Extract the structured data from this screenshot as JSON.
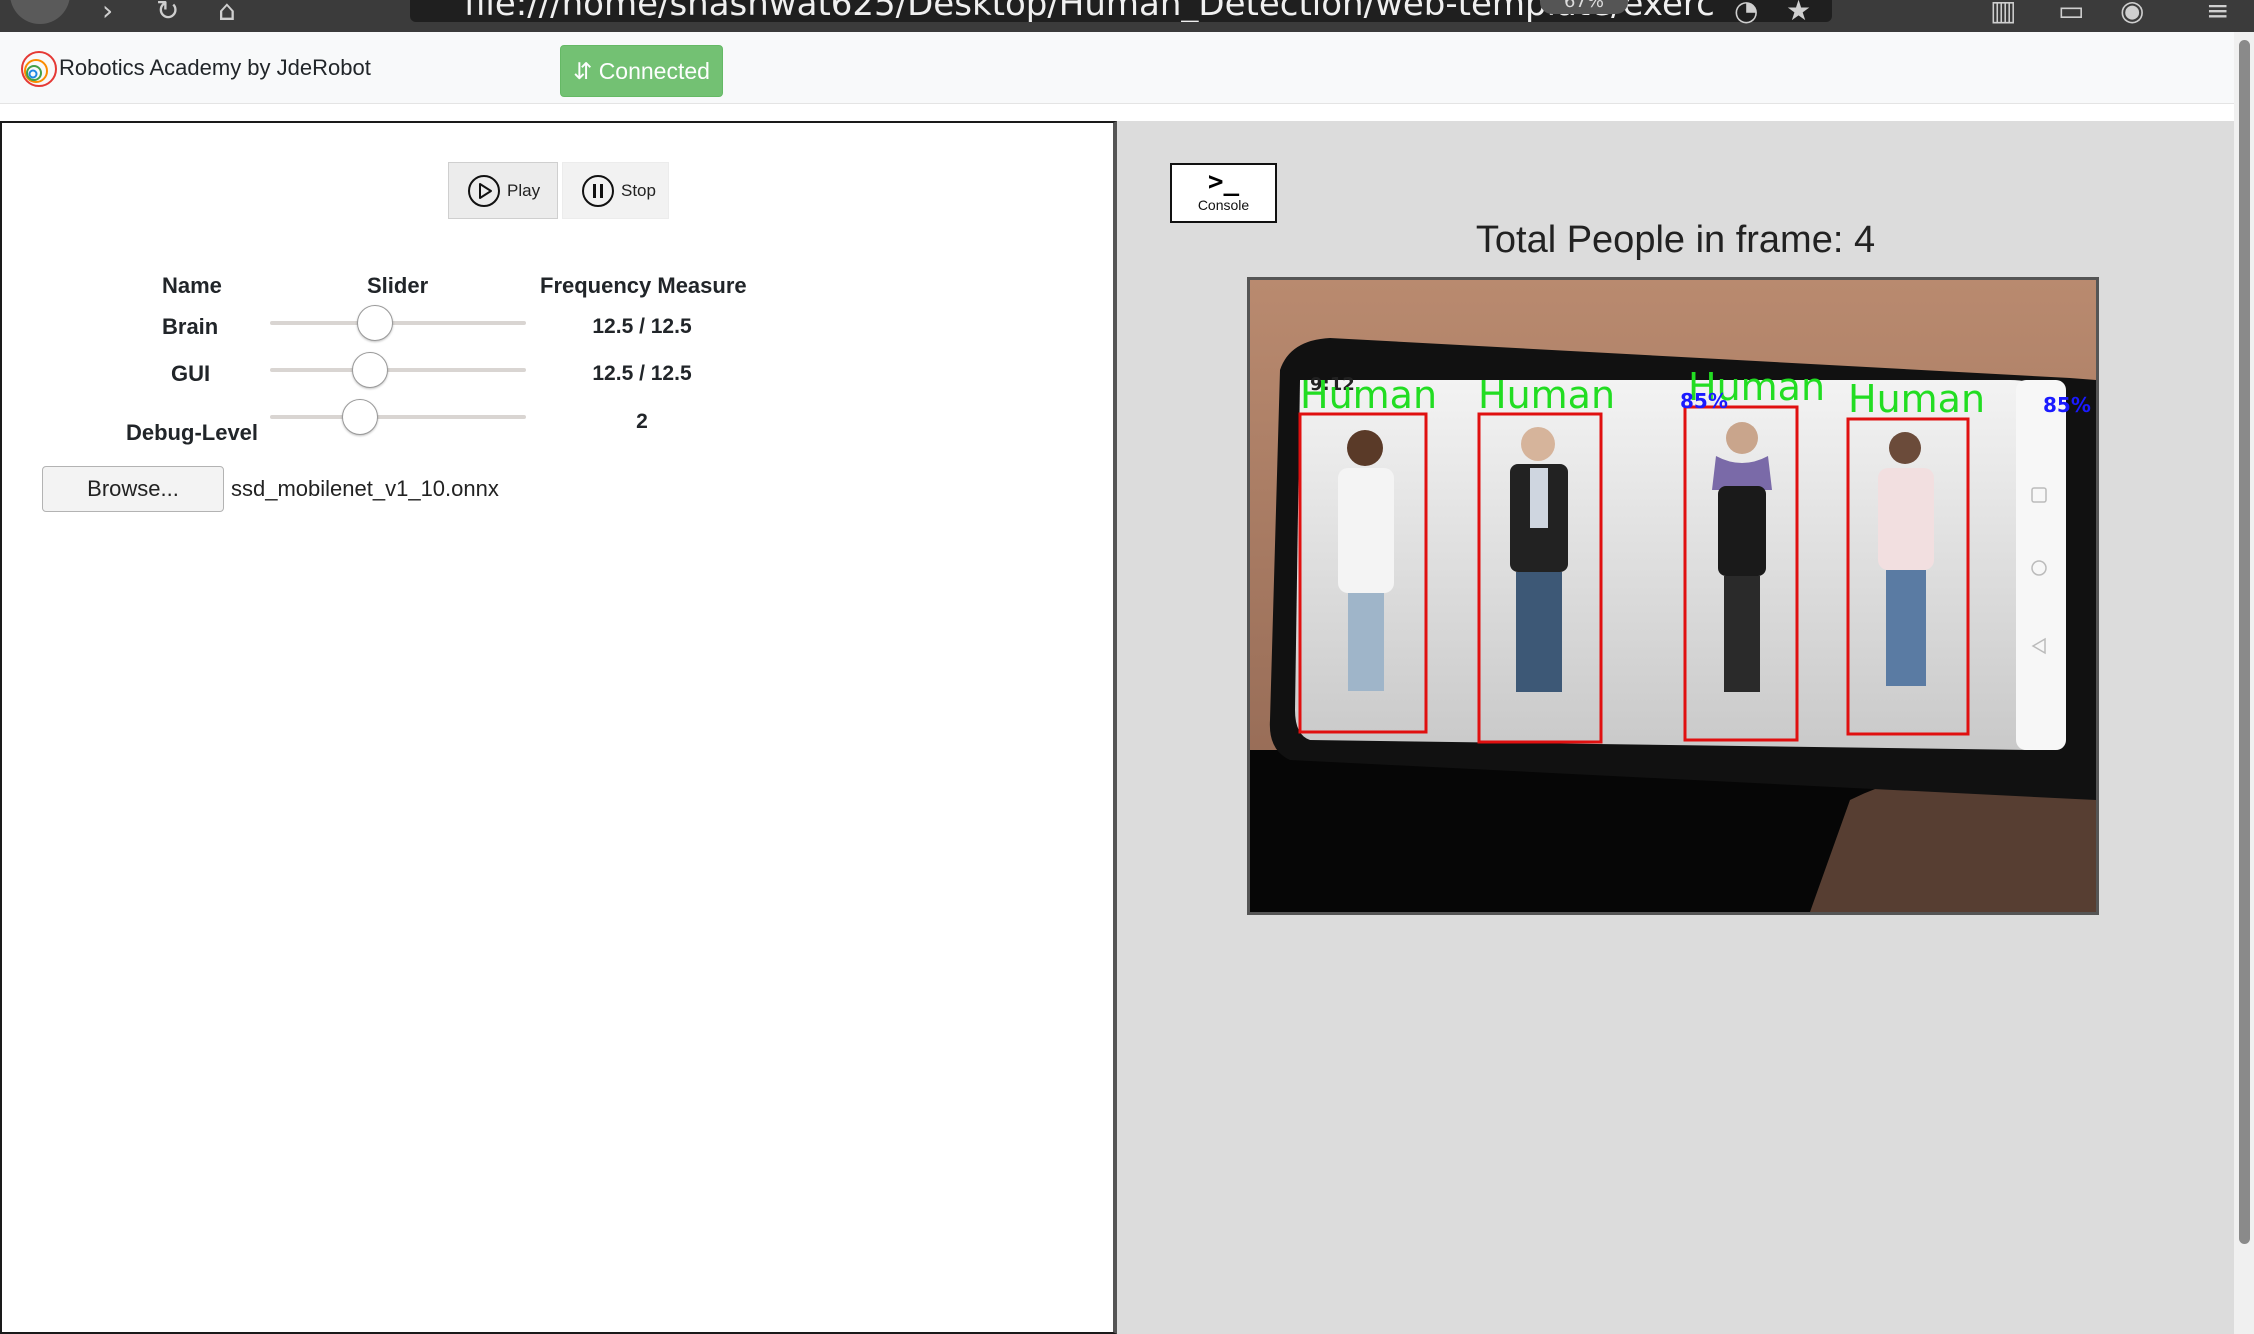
{
  "browser": {
    "url": "file:///home/shashwat625/Desktop/Human_Detection/web-template/exerc",
    "zoom": "67%"
  },
  "header": {
    "brand_name": "Robotics Academy by JdeRobot",
    "connection_status": "⇵ Connected",
    "connection_color": "#5cb85c"
  },
  "controls": {
    "play_label": "Play",
    "stop_label": "Stop"
  },
  "frequency_table": {
    "headers": {
      "name": "Name",
      "slider": "Slider",
      "frequency": "Frequency Measure"
    },
    "rows": [
      {
        "name": "Brain",
        "slider_fraction": 0.41,
        "value": "12.5 / 12.5"
      },
      {
        "name": "GUI",
        "slider_fraction": 0.39,
        "value": "12.5 / 12.5"
      },
      {
        "name": "Debug-Level",
        "slider_fraction": 0.35,
        "value": "2"
      }
    ]
  },
  "model_file": {
    "browse_label": "Browse...",
    "file_name": "ssd_mobilenet_v1_10.onnx"
  },
  "console": {
    "glyph": ">_",
    "label": "Console"
  },
  "viewer": {
    "people_count_text": "Total People in frame: 4",
    "detection_label": "Human",
    "detection_label_color": "#22dd22",
    "box_color": "#e01010",
    "phone_status_time": "9:12",
    "detections": [
      {
        "label": "Human",
        "score": ""
      },
      {
        "label": "Human",
        "score": ""
      },
      {
        "label": "Human",
        "score": "85%"
      },
      {
        "label": "Human",
        "score": "85%"
      }
    ]
  }
}
